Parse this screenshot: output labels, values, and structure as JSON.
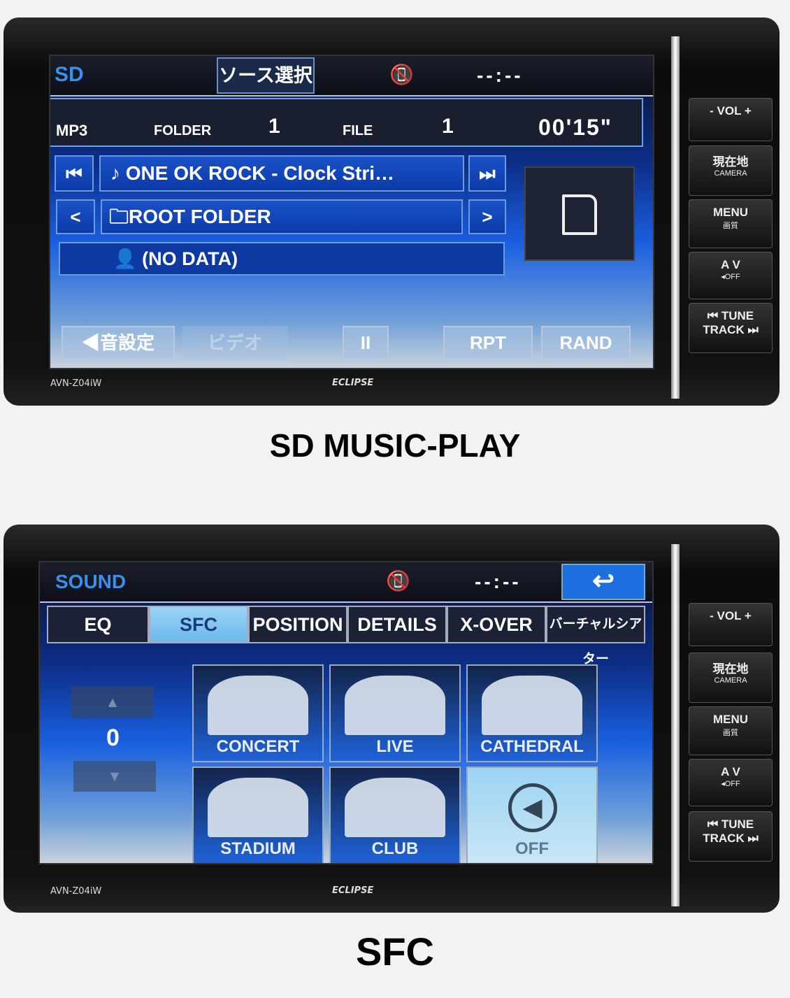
{
  "unit": {
    "model": "AVN-Z04iW",
    "brand": "ECLIPSE",
    "side_buttons": [
      {
        "main": "- VOL +",
        "sub": ""
      },
      {
        "main": "現在地",
        "sub": "CAMERA"
      },
      {
        "main": "MENU",
        "sub": "画質"
      },
      {
        "main": "A V",
        "sub": "◂OFF"
      },
      {
        "main": "⏮ TUNE TRACK ⏭",
        "sub": ""
      }
    ]
  },
  "screen1": {
    "source": "SD",
    "source_select": "ソース選択",
    "clock": "--:--",
    "format": "MP3",
    "folder_label": "FOLDER",
    "folder_num": "1",
    "file_label": "FILE",
    "file_num": "1",
    "elapsed": "00'15\"",
    "track": "ONE OK ROCK - Clock Stri…",
    "folder": "ROOT FOLDER",
    "artist": "(NO DATA)",
    "buttons": {
      "sound": "音設定",
      "video": "ビデオ",
      "pause": "II",
      "repeat": "RPT",
      "random": "RAND"
    }
  },
  "caption1": "SD MUSIC-PLAY",
  "screen2": {
    "title": "SOUND",
    "clock": "--:--",
    "tabs": [
      {
        "label": "EQ",
        "active": false
      },
      {
        "label": "SFC",
        "active": true
      },
      {
        "label": "POSITION",
        "active": false
      },
      {
        "label": "DETAILS",
        "active": false
      },
      {
        "label": "X-OVER",
        "active": false
      },
      {
        "label": "バーチャルシアター",
        "active": false
      }
    ],
    "level": "0",
    "modes": [
      {
        "label": "CONCERT",
        "selected": false
      },
      {
        "label": "LIVE",
        "selected": false
      },
      {
        "label": "CATHEDRAL",
        "selected": false
      },
      {
        "label": "STADIUM",
        "selected": false
      },
      {
        "label": "CLUB",
        "selected": false
      },
      {
        "label": "OFF",
        "selected": true
      }
    ]
  },
  "caption2": "SFC"
}
